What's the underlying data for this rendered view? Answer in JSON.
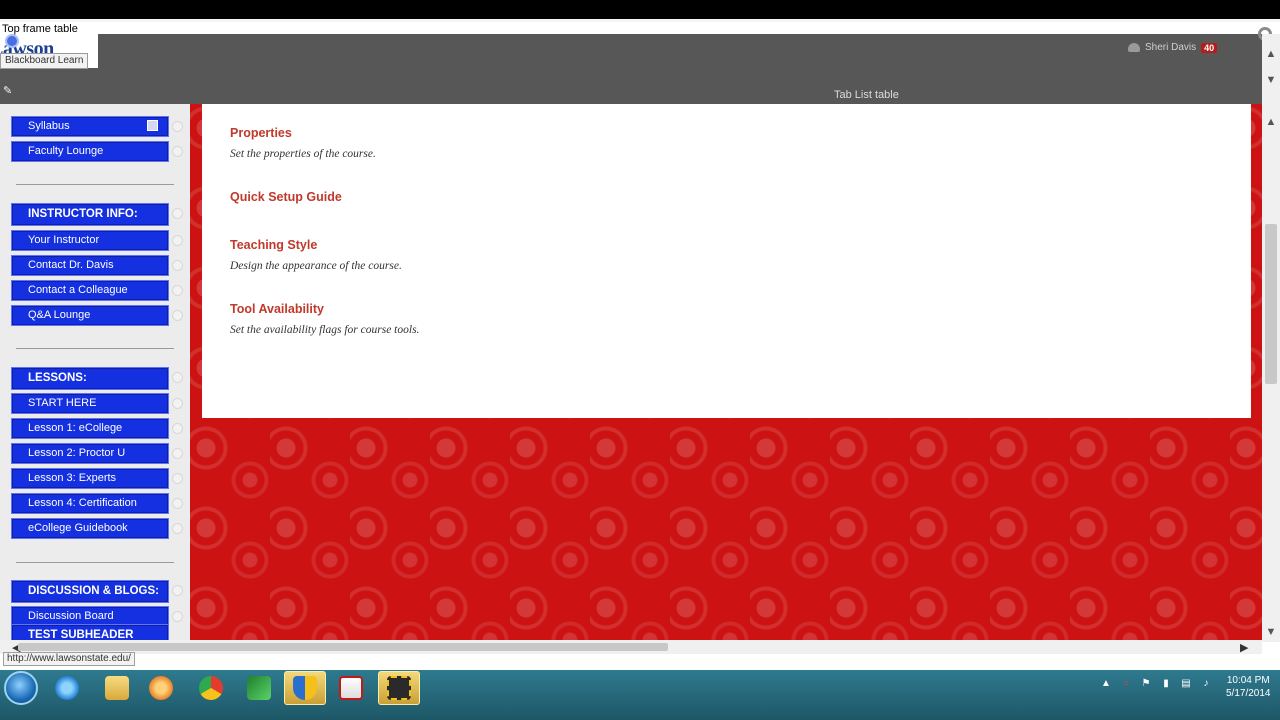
{
  "top_frame": {
    "label": "Top frame table"
  },
  "logo": {
    "text": "Lawson State"
  },
  "tooltip": {
    "text": "Blackboard Learn"
  },
  "header": {
    "user_name": "Sheri Davis",
    "notification_count": "40",
    "tab_list_label": "Tab List table"
  },
  "sidebar": {
    "items": [
      {
        "label": "Syllabus",
        "type": "item"
      },
      {
        "label": "Faculty Lounge",
        "type": "item"
      },
      {
        "label": "INSTRUCTOR INFO:",
        "type": "header"
      },
      {
        "label": "Your Instructor",
        "type": "item"
      },
      {
        "label": "Contact Dr. Davis",
        "type": "item"
      },
      {
        "label": "Contact a Colleague",
        "type": "item"
      },
      {
        "label": "Q&A Lounge",
        "type": "item"
      },
      {
        "label": "LESSONS:",
        "type": "header"
      },
      {
        "label": "START HERE",
        "type": "item"
      },
      {
        "label": "Lesson 1: eCollege",
        "type": "item"
      },
      {
        "label": "Lesson 2: Proctor U",
        "type": "item"
      },
      {
        "label": "Lesson 3: Experts",
        "type": "item"
      },
      {
        "label": "Lesson 4: Certification",
        "type": "item"
      },
      {
        "label": "eCollege Guidebook",
        "type": "item"
      },
      {
        "label": "DISCUSSION & BLOGS:",
        "type": "header"
      },
      {
        "label": "Discussion Board",
        "type": "item"
      },
      {
        "label": "TEST SUBHEADER",
        "type": "header"
      }
    ]
  },
  "main": {
    "entries": [
      {
        "title": "Properties",
        "description": "Set the properties of the course."
      },
      {
        "title": "Quick Setup Guide",
        "description": ""
      },
      {
        "title": "Teaching Style",
        "description": "Design the appearance of the course."
      },
      {
        "title": "Tool Availability",
        "description": "Set the availability flags for course tools."
      }
    ]
  },
  "status_bar": {
    "url": "http://www.lawsonstate.edu/"
  },
  "taskbar": {
    "apps": [
      "internet-explorer",
      "file-explorer",
      "media-player",
      "chrome",
      "stock-app",
      "security-shield",
      "acrobat-reader",
      "snipping-tool"
    ],
    "active_app": "snipping-tool",
    "time": "10:04 PM",
    "date": "5/17/2014"
  },
  "colors": {
    "nav_blue": "#1530e0",
    "accent_red": "#cc1212",
    "title_red": "#c0392b",
    "header_gray": "#575757"
  }
}
